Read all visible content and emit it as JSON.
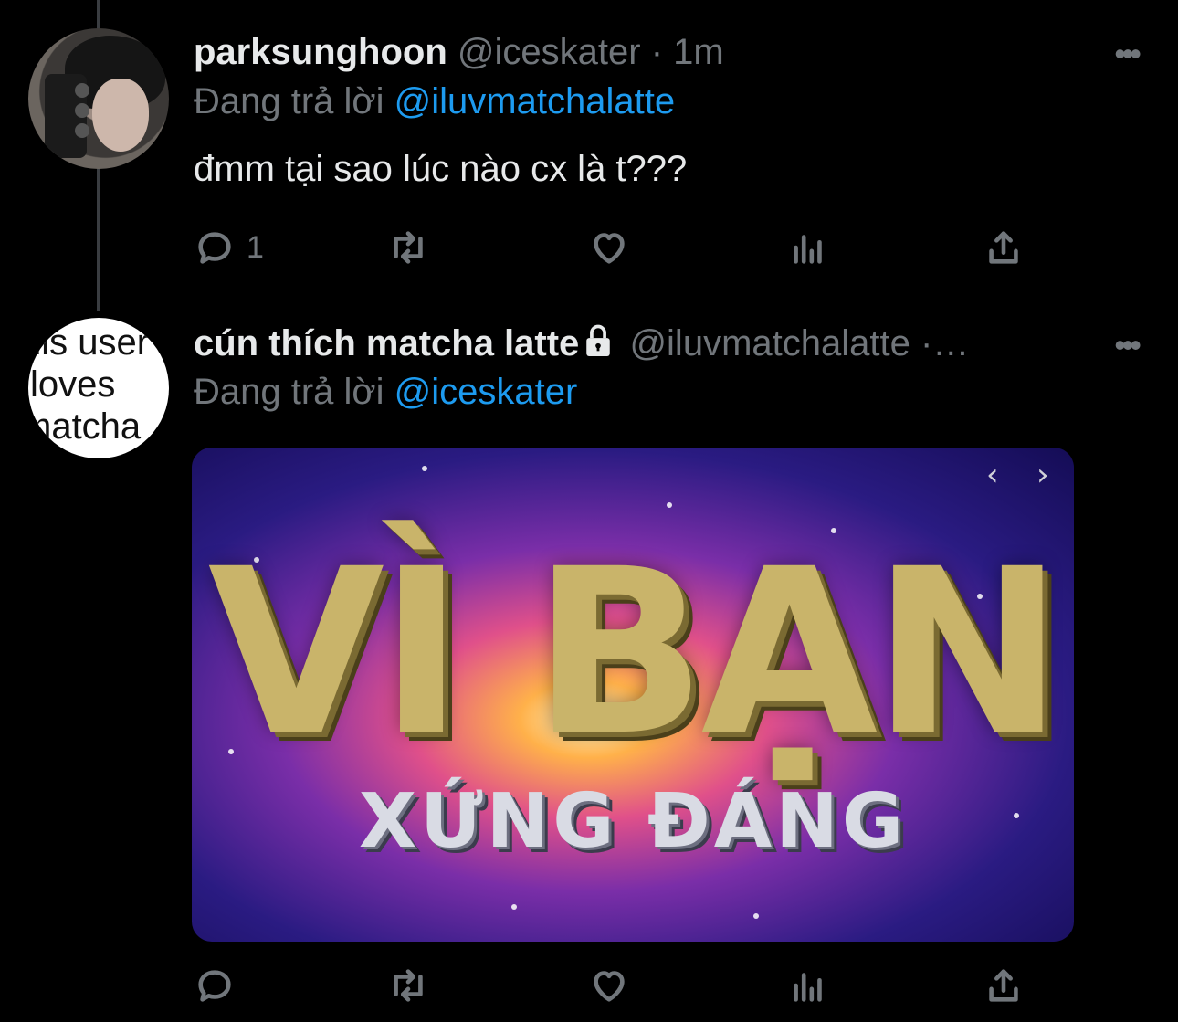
{
  "tweets": [
    {
      "name": "parksunghoon",
      "handle": "@iceskater",
      "time_sep": "·",
      "time": "1m",
      "replying_prefix": "Đang trả lời",
      "replying_to": "@iluvmatchalatte",
      "text": "đmm tại sao lúc nào cx là t???",
      "reply_count": "1",
      "avatar_icon": "user-photo-avatar"
    },
    {
      "name": "cún thích matcha latte",
      "handle": "@iluvmatchalatte",
      "time_sep": "·…",
      "replying_prefix": "Đang trả lời",
      "replying_to": "@iceskater",
      "avatar_text": [
        "his user",
        "loves",
        "matcha"
      ],
      "media": {
        "line1": "VÌ BẠN",
        "line2": "XỨNG ĐÁNG",
        "prev": "‹",
        "next": "›"
      }
    }
  ],
  "icons": {
    "more": "more-icon",
    "reply": "reply-icon",
    "retweet": "retweet-icon",
    "like": "like-icon",
    "views": "views-icon",
    "share": "share-icon",
    "lock": "lock-icon"
  },
  "colors": {
    "background": "#000000",
    "text": "#e7e9ea",
    "muted": "#71767b",
    "accent": "#1d9bf0"
  },
  "more_glyph": "•••"
}
